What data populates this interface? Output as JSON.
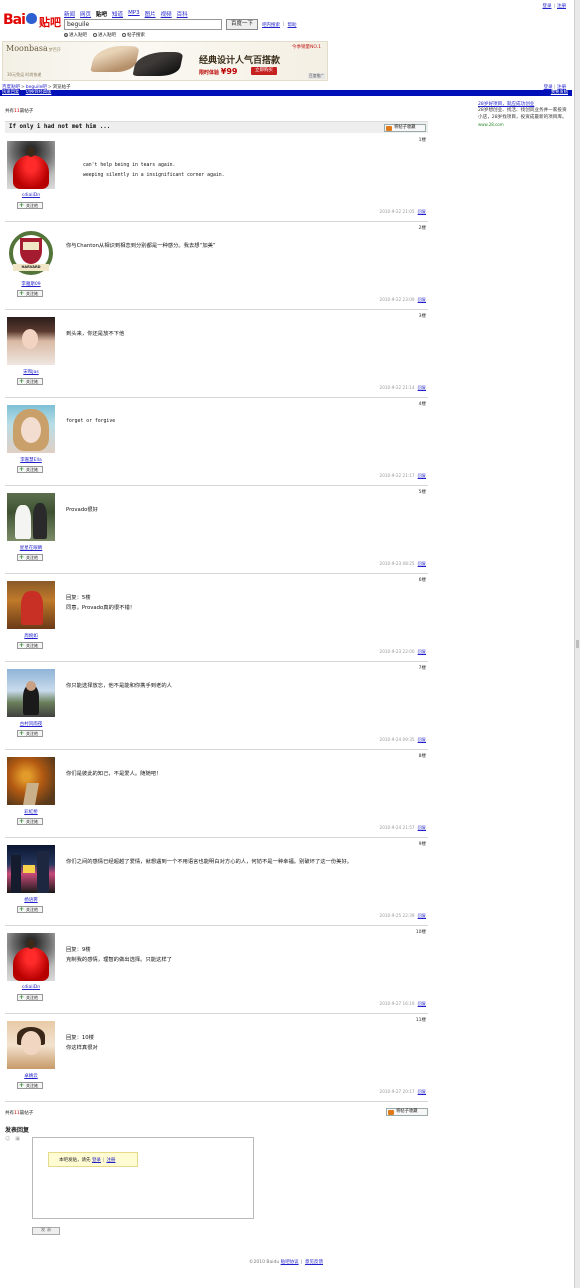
{
  "top_links": {
    "login": "登录",
    "register": "注册"
  },
  "header": {
    "logo_bai": "Bai",
    "logo_tieba": "贴吧",
    "nav": [
      "新闻",
      "网页",
      "贴吧",
      "知道",
      "MP3",
      "图片",
      "视频",
      "百科"
    ],
    "nav_current": 2,
    "search_value": "beguile",
    "search_button": "百度一下",
    "search_links": [
      "吧内搜索",
      "帮助"
    ],
    "radios": [
      "进入贴吧",
      "进入贴吧",
      "帖子搜索"
    ],
    "radio_selected": 0
  },
  "banner": {
    "brand": "Moonbasa",
    "brand_sub": "梦芭莎",
    "promo": "今季销量NO.1",
    "headline": "经典设计人气百搭款",
    "deal": "限时体验",
    "price": "¥99",
    "buy": "立即购买",
    "tagline": "30元免运 时尚快递",
    "ad_label": "百度推广"
  },
  "crumbs": {
    "items": [
      "百度贴吧",
      "beguile吧",
      "浏览帖子"
    ]
  },
  "login_links": {
    "login": "登录",
    "register": "注册"
  },
  "bluebar": {
    "links": [
      "快速回复",
      "切换到经典版"
    ],
    "right": "我要发帖"
  },
  "thread": {
    "count_prefix": "共有",
    "count": "11",
    "count_suffix": "篇帖子",
    "title": "If only i had not met him ...",
    "fav_label": "将帖子收藏"
  },
  "posts": [
    {
      "floor": "1楼",
      "user": "cdiaiiDn",
      "lines": [
        "can't help being in tears again.",
        "weeping silently in a insignificant corner again."
      ],
      "time": "2010-9-22 21:05",
      "reply": "回复",
      "follow": "关注他"
    },
    {
      "floor": "2楼",
      "user": "李雅斯09",
      "lines": [
        "你与Chanton从相识到相恋到分别都是一种感分。我去想“加美”"
      ],
      "time": "2010-9-22 23:09",
      "reply": "回复",
      "follow": "关注她"
    },
    {
      "floor": "3楼",
      "user": "宋和Jas",
      "lines": [
        "到头来，你还是放不下他"
      ],
      "time": "2010-9-22 21:14",
      "reply": "回复",
      "follow": "关注她"
    },
    {
      "floor": "4楼",
      "user": "李嘉慧Ella",
      "lines": [
        "forget or forgive"
      ],
      "time": "2010-9-22 21:17",
      "reply": "回复",
      "follow": "关注她"
    },
    {
      "floor": "5楼",
      "user": "星星在眼睛",
      "lines": [
        "Provado很好"
      ],
      "time": "2010-9-23 08:25",
      "reply": "回复",
      "follow": "关注他"
    },
    {
      "floor": "6楼",
      "user": "周婉如",
      "lines": [
        "回复：5楼",
        "同意。Provado真的很不错！"
      ],
      "time": "2010-9-23 22:00",
      "reply": "回复",
      "follow": "关注她"
    },
    {
      "floor": "7楼",
      "user": "古村风雨夜",
      "lines": [
        "你只能选择放忘，他不是能和你携手到老的人"
      ],
      "time": "2010-9-24 09:35",
      "reply": "回复",
      "follow": "关注他"
    },
    {
      "floor": "8楼",
      "user": "彩虹桥",
      "lines": [
        "你们是彼此的知己，不是爱人。随随吧！"
      ],
      "time": "2010-9-24 21:57",
      "reply": "回复",
      "follow": "关注她"
    },
    {
      "floor": "9楼",
      "user": "杨语霁",
      "lines": [
        "你们之间的感情已经超越了爱情，就想遇到一个不用语言也能明白对方心的人，何妨不是一种幸福。别破坏了这一份美好。"
      ],
      "time": "2010-9-25 22:39",
      "reply": "回复",
      "follow": "关注他"
    },
    {
      "floor": "10楼",
      "user": "cdiaiiDn",
      "lines": [
        "回复：9楼",
        "克制我的感情，理智的做出选择。只能这样了"
      ],
      "time": "2010-9-27 16:19",
      "reply": "回复",
      "follow": "关注他"
    },
    {
      "floor": "11楼",
      "user": "卓婧云",
      "lines": [
        "回复：10楼",
        "你这样真很对"
      ],
      "time": "2010-9-27 20:17",
      "reply": "回复",
      "follow": "关注她"
    }
  ],
  "bottom": {
    "count_prefix": "共有",
    "count": "11",
    "count_suffix": "篇帖子",
    "fav_label": "将帖子收藏",
    "reply_title": "发表回复",
    "login_tip_prefix": "本吧发贴，请先",
    "login_tip_login": "登录",
    "login_tip_register": "注册",
    "submit": "发 表"
  },
  "footer": {
    "copyright": "©2010 Baidu",
    "links": [
      "贴吧协议",
      "意见反馈"
    ]
  },
  "sidebar": {
    "title": "28岁好项目，就应成功创业",
    "body": "28岁想创业、找活、找创风业务并一家投资小店，28岁找项目，投资成最新的项目库。",
    "url": "www.28.com"
  }
}
